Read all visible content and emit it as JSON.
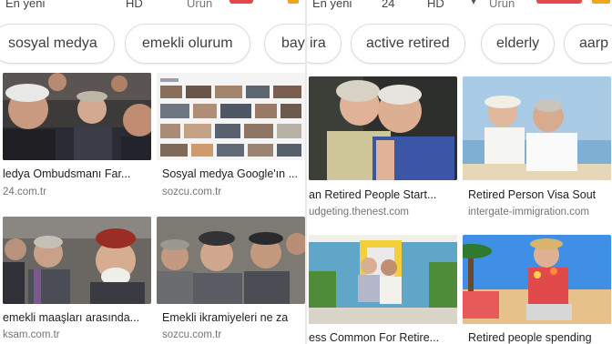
{
  "colors": {
    "accent_red": "#e5484d",
    "accent_orange": "#f2a51a",
    "chip_border": "#dadce0",
    "source_text": "#70757a"
  },
  "left": {
    "topbar": {
      "item1": "En yeni",
      "item2": "HD",
      "item3": "Ürün"
    },
    "chips": [
      "sosyal medya",
      "emekli olurum",
      "bay"
    ],
    "results": [
      {
        "title": "ledya Ombudsmanı Far...",
        "source": "24.com.tr"
      },
      {
        "title": "Sosyal medya Google'ın ...",
        "source": "sozcu.com.tr"
      },
      {
        "title": "emekli maaşları arasında...",
        "source": "ksam.com.tr"
      },
      {
        "title": "Emekli ikramiyeleri ne za",
        "source": "sozcu.com.tr"
      }
    ]
  },
  "right": {
    "topbar": {
      "item1": "En yeni",
      "item2": "24",
      "item3": "HD",
      "item4": "Ürün"
    },
    "chips": [
      "ira",
      "active retired",
      "elderly",
      "aarp"
    ],
    "results": [
      {
        "title": "an Retired People Start...",
        "source": "udgeting.thenest.com"
      },
      {
        "title": "Retired Person Visa Sout",
        "source": "intergate-immigration.com"
      },
      {
        "title": "ess Common For Retire...",
        "source": ""
      },
      {
        "title": "Retired people spending",
        "source": ""
      }
    ]
  }
}
